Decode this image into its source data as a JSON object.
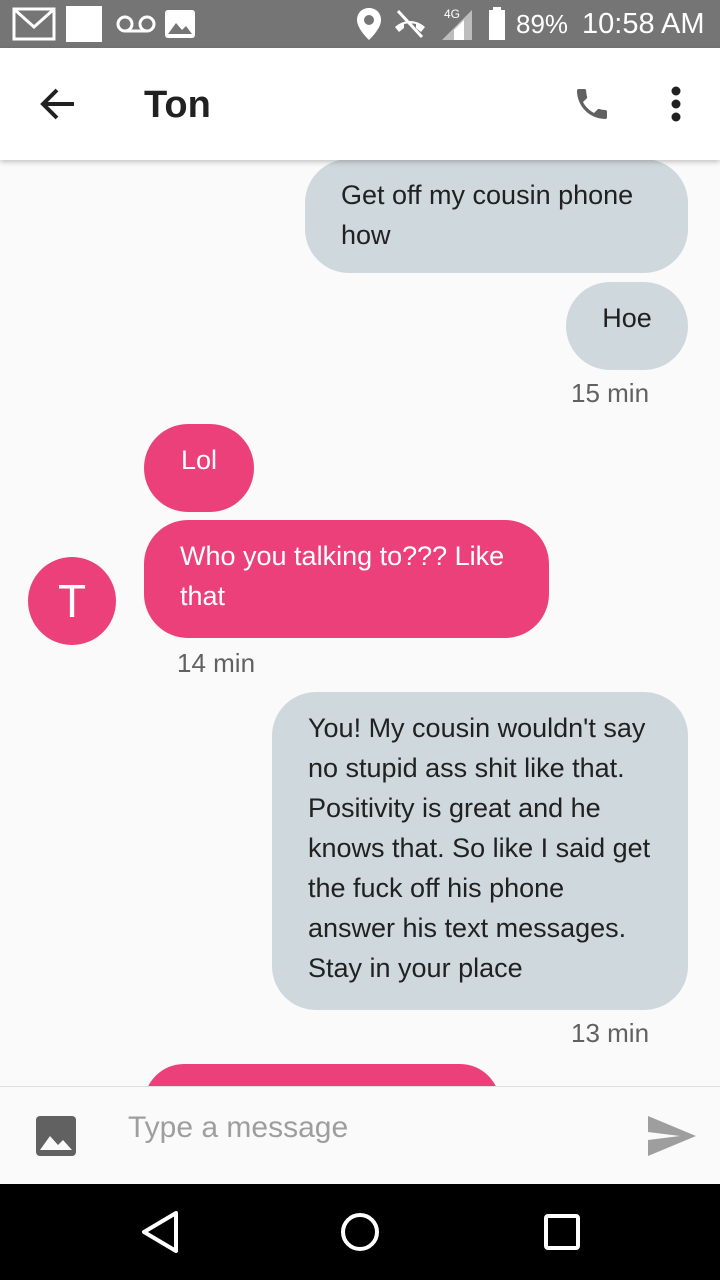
{
  "status_bar": {
    "network_label": "4G",
    "battery": "89%",
    "time": "10:58 AM"
  },
  "header": {
    "contact_name": "Ton"
  },
  "messages": [
    {
      "direction": "outgoing",
      "text": "Get off my cousin phone how"
    },
    {
      "direction": "outgoing",
      "text": "Hoe"
    },
    {
      "direction": "incoming",
      "text": "Lol"
    },
    {
      "direction": "incoming",
      "text": "Who you talking to??? Like that"
    },
    {
      "direction": "outgoing",
      "text": "You! My cousin wouldn't say no stupid ass shit like that. Positivity is great and he knows that. So like I said get the fuck off his phone answer his text messages. Stay in your place"
    }
  ],
  "timestamps": [
    "15 min",
    "14 min",
    "13 min"
  ],
  "avatar_initial": "T",
  "composer": {
    "placeholder": "Type a message"
  },
  "colors": {
    "incoming_bubble": "#ec407a",
    "outgoing_bubble": "#cfd8dc",
    "status_bar": "#757575"
  },
  "icons": [
    "gmail-icon",
    "voicemail-icon",
    "image-icon",
    "location-icon",
    "no-call-icon",
    "signal-icon",
    "battery-icon",
    "back-arrow-icon",
    "phone-icon",
    "more-vert-icon",
    "attach-image-icon",
    "send-icon",
    "nav-back-icon",
    "nav-home-icon",
    "nav-recents-icon"
  ]
}
